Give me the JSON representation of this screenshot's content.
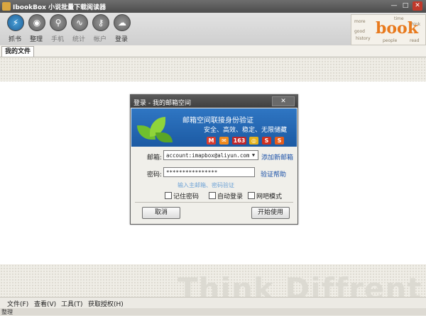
{
  "window": {
    "title": "IbookBox 小说批量下载阅读器",
    "controls": {
      "minimize": "—",
      "maximize": "□",
      "close": "✕"
    }
  },
  "toolbar": {
    "items": [
      {
        "label": "抓书",
        "icon": "lightning-icon"
      },
      {
        "label": "整理",
        "icon": "disc-icon"
      },
      {
        "label": "手机",
        "icon": "magnifier-icon"
      },
      {
        "label": "统计",
        "icon": "wave-icon"
      },
      {
        "label": "帐户",
        "icon": "key-icon"
      },
      {
        "label": "登录",
        "icon": "cloud-up-icon"
      }
    ]
  },
  "logo": {
    "word": "book",
    "small": [
      "more",
      "time",
      "good",
      "history",
      "think",
      "people",
      "read"
    ]
  },
  "tabs": [
    "我的文件"
  ],
  "watermark": "Think Diffrent",
  "menubar": [
    "文件(F)",
    "查看(V)",
    "工具(T)",
    "获取授权(H)"
  ],
  "status": "整理",
  "dialog": {
    "title": "登录 - 我的邮箱空间",
    "close": "✕",
    "banner_line1": "邮箱空间联接身份验证",
    "banner_line2": "安全、高效、稳定、无限储藏",
    "providers": [
      "M",
      "✉",
      "163",
      "◎",
      "S",
      "S"
    ],
    "email_label": "邮箱:",
    "email_value": "account:imapbox@aliyun.com",
    "add_email": "添加新邮箱",
    "password_label": "密码:",
    "password_value": "****************",
    "verify_help": "验证帮助",
    "hint": "输入主邮箱、密码验证",
    "remember": "记住密码",
    "auto_login": "自动登录",
    "netbar": "网吧模式",
    "cancel": "取消",
    "start": "开始使用"
  }
}
